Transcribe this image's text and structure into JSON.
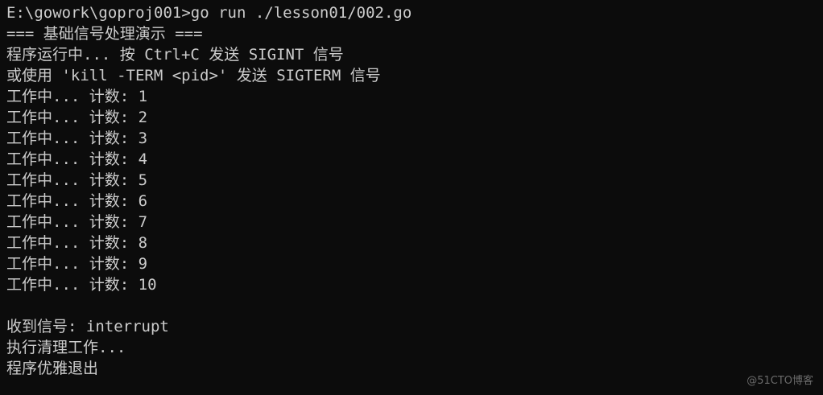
{
  "terminal": {
    "lines": [
      "E:\\gowork\\goproj001>go run ./lesson01/002.go",
      "=== 基础信号处理演示 ===",
      "程序运行中... 按 Ctrl+C 发送 SIGINT 信号",
      "或使用 'kill -TERM <pid>' 发送 SIGTERM 信号",
      "工作中... 计数: 1",
      "工作中... 计数: 2",
      "工作中... 计数: 3",
      "工作中... 计数: 4",
      "工作中... 计数: 5",
      "工作中... 计数: 6",
      "工作中... 计数: 7",
      "工作中... 计数: 8",
      "工作中... 计数: 9",
      "工作中... 计数: 10",
      "",
      "收到信号: interrupt",
      "执行清理工作...",
      "程序优雅退出"
    ]
  },
  "watermark": "@51CTO博客",
  "colors": {
    "background": "#0c0c0c",
    "text": "#cccccc"
  }
}
